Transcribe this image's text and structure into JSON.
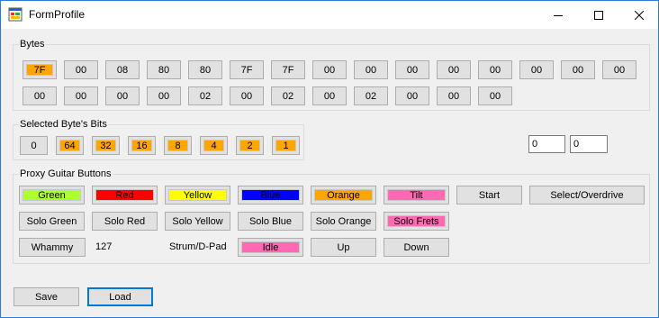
{
  "window": {
    "title": "FormProfile",
    "minimize_icon": "minimize-icon",
    "maximize_icon": "maximize-icon",
    "close_icon": "close-icon"
  },
  "colors": {
    "orange": "#ffa500",
    "green": "#adff2f",
    "red": "#ff0000",
    "yellow": "#ffff00",
    "blue": "#0000ff",
    "pink": "#ff69b4",
    "default": "#e1e1e1"
  },
  "bytes": {
    "legend": "Bytes",
    "row1": [
      "7F",
      "00",
      "08",
      "80",
      "80",
      "7F",
      "7F",
      "00",
      "00",
      "00",
      "00",
      "00",
      "00",
      "00",
      "00"
    ],
    "row2": [
      "00",
      "00",
      "00",
      "00",
      "02",
      "00",
      "02",
      "00",
      "02",
      "00",
      "00",
      "00"
    ]
  },
  "bits": {
    "legend": "Selected Byte's Bits",
    "values": [
      "0",
      "64",
      "32",
      "16",
      "8",
      "4",
      "2",
      "1"
    ]
  },
  "textboxes": [
    "0",
    "0"
  ],
  "guitar": {
    "legend": "Proxy Guitar Buttons",
    "row1": [
      "Green",
      "Red",
      "Yellow",
      "Blue",
      "Orange",
      "Tilt",
      "Start",
      "Select/Overdrive"
    ],
    "row2": [
      "Solo Green",
      "Solo Red",
      "Solo Yellow",
      "Solo Blue",
      "Solo Orange",
      "Solo Frets"
    ],
    "whammy_label": "Whammy",
    "whammy_value": "127",
    "strum_label": "Strum/D-Pad",
    "row3": [
      "Idle",
      "Up",
      "Down"
    ]
  },
  "footer": {
    "save_label": "Save",
    "load_label": "Load"
  }
}
